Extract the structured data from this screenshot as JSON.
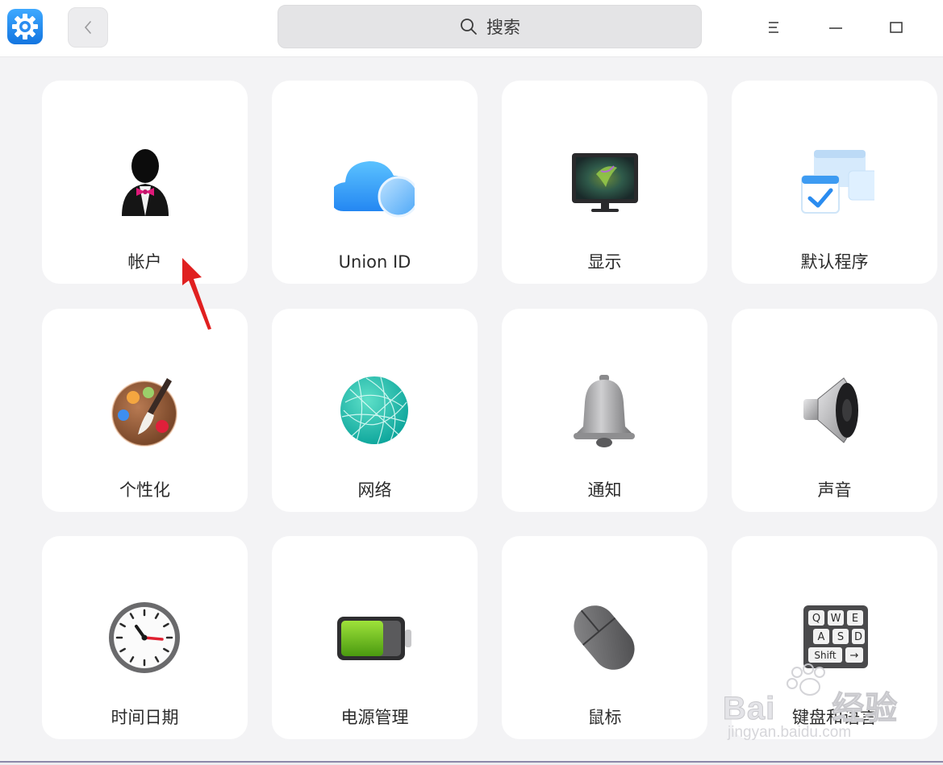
{
  "titlebar": {
    "search_placeholder": "搜索"
  },
  "modules": [
    {
      "label": "帐户",
      "icon": "account-icon"
    },
    {
      "label": "Union ID",
      "icon": "cloud-icon"
    },
    {
      "label": "显示",
      "icon": "display-icon"
    },
    {
      "label": "默认程序",
      "icon": "default-apps-icon"
    },
    {
      "label": "个性化",
      "icon": "palette-icon"
    },
    {
      "label": "网络",
      "icon": "network-globe-icon"
    },
    {
      "label": "通知",
      "icon": "bell-icon"
    },
    {
      "label": "声音",
      "icon": "speaker-icon"
    },
    {
      "label": "时间日期",
      "icon": "clock-icon"
    },
    {
      "label": "电源管理",
      "icon": "battery-icon"
    },
    {
      "label": "鼠标",
      "icon": "mouse-icon"
    },
    {
      "label": "键盘和语言",
      "icon": "keyboard-icon"
    }
  ],
  "keyboard_keys": [
    "Q",
    "W",
    "E",
    "A",
    "S",
    "D",
    "Shift"
  ],
  "watermark": {
    "brand": "Bai",
    "brand_suffix": "经验",
    "url": "jingyan.baidu.com"
  },
  "colors": {
    "accent": "#1f8bea",
    "card_bg": "#ffffff",
    "window_bg": "#f3f3f5",
    "arrow": "#e02020"
  }
}
